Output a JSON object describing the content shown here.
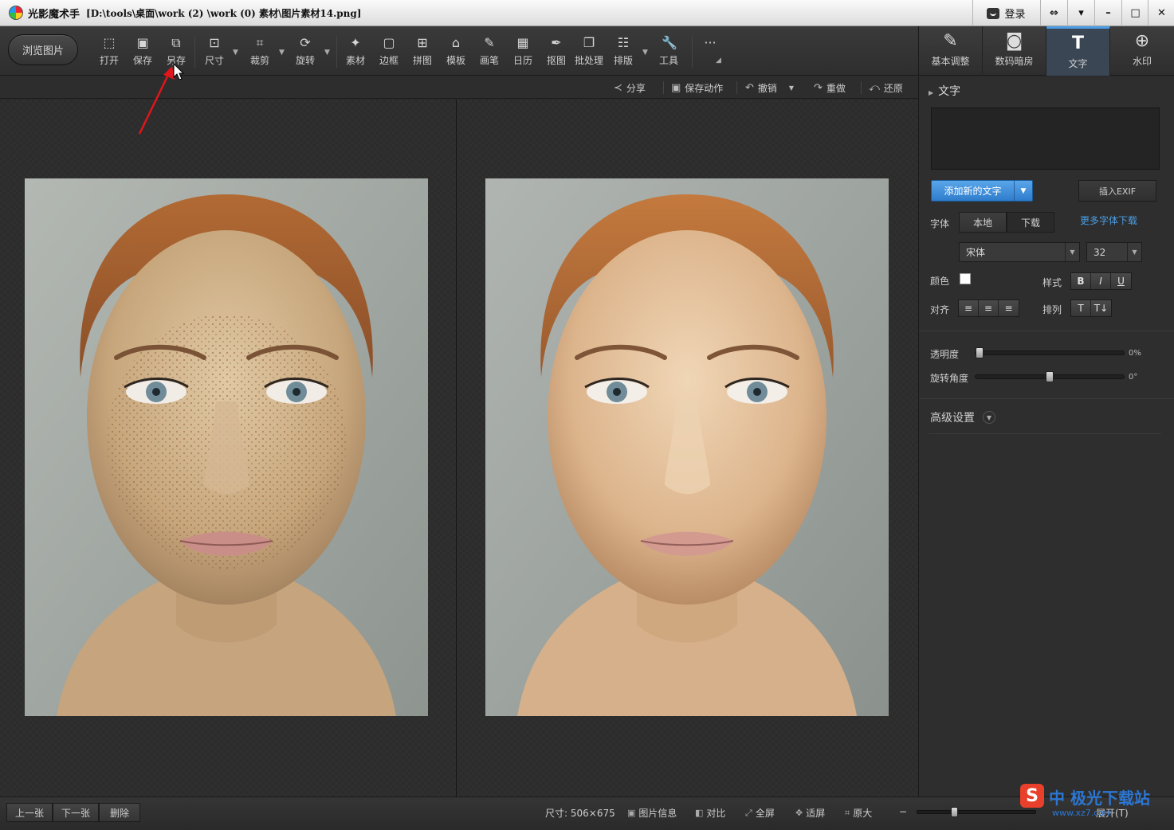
{
  "window": {
    "app_name": "光影魔术手",
    "file_path": "[D:\\tools\\桌面\\work (2) \\work (0) 素材\\图片素材14.png]",
    "login_label": "登录",
    "controls": [
      "⇔",
      "▾",
      "–",
      "□",
      "✕"
    ]
  },
  "toolbar": {
    "browse_label": "浏览图片",
    "tools": [
      {
        "icon": "open-icon",
        "glyph": "⬚",
        "label": "打开"
      },
      {
        "icon": "save-icon",
        "glyph": "▣",
        "label": "保存"
      },
      {
        "icon": "save-as-icon",
        "glyph": "⧉",
        "label": "另存"
      },
      {
        "icon": "resize-icon",
        "glyph": "⊡",
        "label": "尺寸"
      },
      {
        "icon": "crop-icon",
        "glyph": "⌗",
        "label": "裁剪"
      },
      {
        "icon": "rotate-icon",
        "glyph": "⟳",
        "label": "旋转"
      },
      {
        "icon": "material-icon",
        "glyph": "✦",
        "label": "素材"
      },
      {
        "icon": "border-icon",
        "glyph": "▢",
        "label": "边框"
      },
      {
        "icon": "collage-icon",
        "glyph": "⊞",
        "label": "拼图"
      },
      {
        "icon": "template-icon",
        "glyph": "⌂",
        "label": "模板"
      },
      {
        "icon": "brush-icon",
        "glyph": "✎",
        "label": "画笔"
      },
      {
        "icon": "calendar-icon",
        "glyph": "▦",
        "label": "日历"
      },
      {
        "icon": "cutout-icon",
        "glyph": "✒",
        "label": "抠图"
      },
      {
        "icon": "batch-icon",
        "glyph": "❐",
        "label": "批处理"
      },
      {
        "icon": "layout-icon",
        "glyph": "☷",
        "label": "排版"
      },
      {
        "icon": "tools-icon",
        "glyph": "🔧",
        "label": "工具"
      }
    ],
    "more_glyph": "···"
  },
  "right_tabs": [
    {
      "icon": "basic-adjust-icon",
      "glyph": "✎",
      "label": "基本调整"
    },
    {
      "icon": "darkroom-icon",
      "glyph": "◙",
      "label": "数码暗房"
    },
    {
      "icon": "text-icon",
      "glyph": "T",
      "label": "文字",
      "active": true
    },
    {
      "icon": "watermark-icon",
      "glyph": "⊕",
      "label": "水印"
    }
  ],
  "subbar": {
    "share": "分享",
    "save_action": "保存动作",
    "undo": "撤销",
    "redo": "重做",
    "restore": "还原"
  },
  "text_panel": {
    "title": "文字",
    "add_text_button": "添加新的文字",
    "insert_exif_button": "插入EXIF",
    "font_label": "字体",
    "font_tab_local": "本地",
    "font_tab_download": "下载",
    "more_fonts_link": "更多字体下载",
    "font_name": "宋体",
    "font_size": "32",
    "color_label": "颜色",
    "color_value": "#ffffff",
    "style_label": "样式",
    "style_buttons": [
      "B",
      "I",
      "U"
    ],
    "align_label": "对齐",
    "align_buttons": [
      "≡",
      "≡",
      "≡"
    ],
    "arrange_label": "排列",
    "arrange_buttons": [
      "T",
      "T↓"
    ],
    "opacity_label": "透明度",
    "opacity_value": "0%",
    "opacity_level": 0,
    "rotation_label": "旋转角度",
    "rotation_value": "0°",
    "rotation_level": 0.5,
    "advanced_label": "高级设置"
  },
  "bottom": {
    "prev": "上一张",
    "next": "下一张",
    "delete": "删除",
    "size_info": "尺寸: 506×675",
    "image_info": "图片信息",
    "compare": "对比",
    "fullscreen": "全屏",
    "fit": "适屏",
    "original": "原大",
    "zoom_minus": "−",
    "expand": "展开(T)"
  },
  "site_watermark": {
    "logo_letter": "S",
    "text": "中 极光下载站",
    "url": "www.xz7.com"
  }
}
